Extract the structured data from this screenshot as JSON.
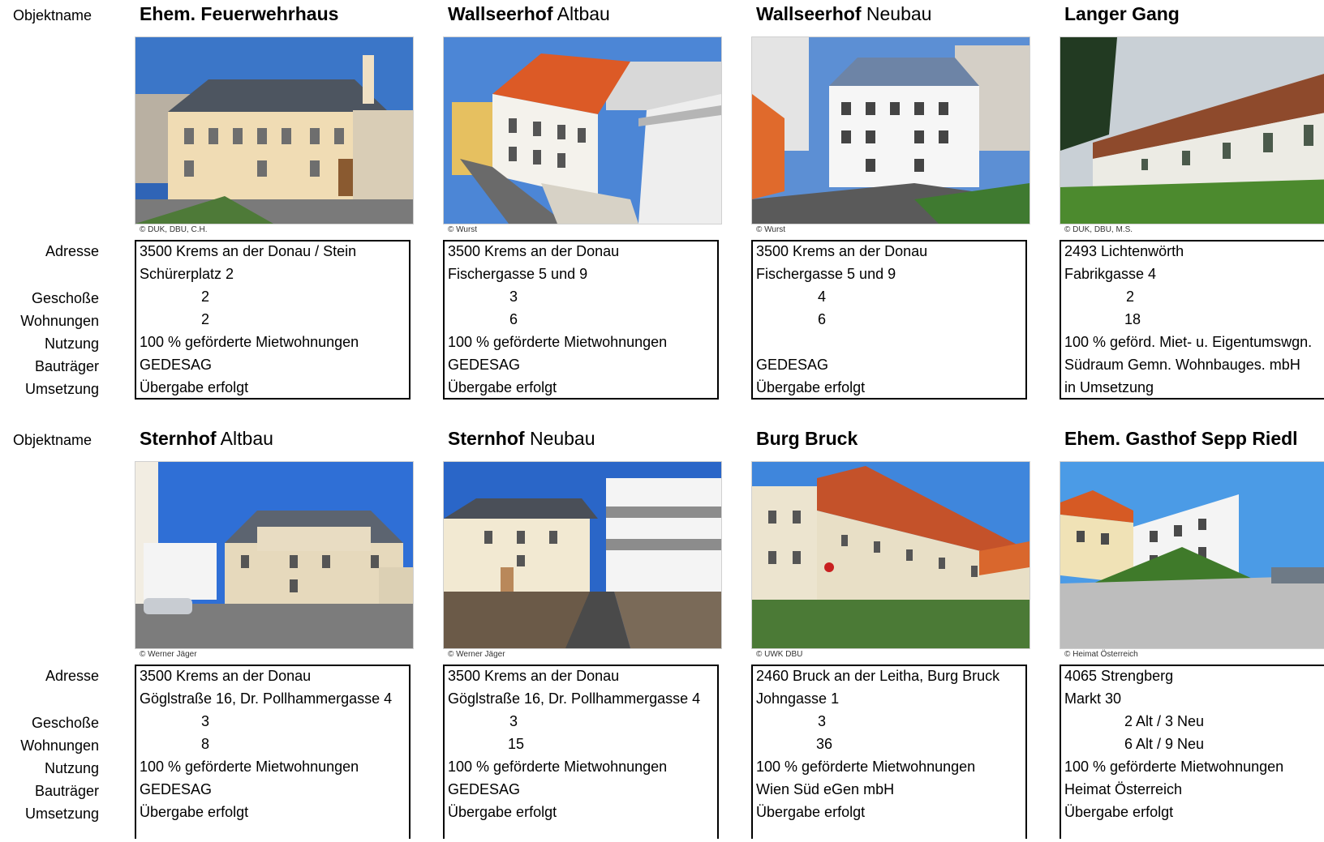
{
  "labels": {
    "objektname": "Objektname",
    "adresse": "Adresse",
    "geschosse": "Geschoße",
    "wohnungen": "Wohnungen",
    "nutzung": "Nutzung",
    "bautraeger": "Bauträger",
    "umsetzung": "Umsetzung"
  },
  "projects": [
    {
      "name_bold": "Ehem. Feuerwehrhaus",
      "name_rest": "",
      "credit": "© DUK, DBU, C.H.",
      "address1": "3500 Krems an der Donau / Stein",
      "address2": "Schürerplatz 2",
      "floors": "2",
      "units": "2",
      "usage": "100 % geförderte Mietwohnungen",
      "developer": "GEDESAG",
      "status": "Übergabe erfolgt"
    },
    {
      "name_bold": "Wallseerhof",
      "name_rest": " Altbau",
      "credit": "© Wurst",
      "address1": "3500 Krems an der Donau",
      "address2": "Fischergasse 5 und 9",
      "floors": "3",
      "units": "6",
      "usage": "100 % geförderte Mietwohnungen",
      "developer": "GEDESAG",
      "status": "Übergabe erfolgt"
    },
    {
      "name_bold": "Wallseerhof",
      "name_rest": " Neubau",
      "credit": "© Wurst",
      "address1": "3500 Krems an der Donau",
      "address2": "Fischergasse 5 und 9",
      "floors": "4",
      "units": "6",
      "usage": "",
      "developer": "GEDESAG",
      "status": "Übergabe erfolgt"
    },
    {
      "name_bold": "Langer Gang",
      "name_rest": "",
      "credit": "© DUK, DBU, M.S.",
      "address1": "2493 Lichtenwörth",
      "address2": "Fabrikgasse 4",
      "floors": "2",
      "units": "18",
      "usage": "100 % geförd. Miet- u. Eigentumswgn.",
      "developer": "Südraum Gemn. Wohnbauges. mbH",
      "status": "in Umsetzung"
    },
    {
      "name_bold": "Sternhof",
      "name_rest": " Altbau",
      "credit": "© Werner Jäger",
      "address1": "3500 Krems an der Donau",
      "address2": "Göglstraße 16, Dr. Pollhammergasse 4",
      "floors": "3",
      "units": "8",
      "usage": "100 % geförderte Mietwohnungen",
      "developer": "GEDESAG",
      "status": "Übergabe erfolgt"
    },
    {
      "name_bold": "Sternhof",
      "name_rest": " Neubau",
      "credit": "© Werner Jäger",
      "address1": "3500 Krems an der Donau",
      "address2": "Göglstraße 16, Dr. Pollhammergasse 4",
      "floors": "3",
      "units": "15",
      "usage": "100 % geförderte Mietwohnungen",
      "developer": "GEDESAG",
      "status": "Übergabe erfolgt"
    },
    {
      "name_bold": "Burg Bruck",
      "name_rest": "",
      "credit": "© UWK DBU",
      "address1": "2460 Bruck an der Leitha, Burg Bruck",
      "address2": "Johngasse 1",
      "floors": "3",
      "units": "36",
      "usage": "100 % geförderte Mietwohnungen",
      "developer": "Wien Süd eGen mbH",
      "status": "Übergabe erfolgt"
    },
    {
      "name_bold": "Ehem. Gasthof Sepp Riedl",
      "name_rest": "",
      "credit": "© Heimat Österreich",
      "address1": "4065 Strengberg",
      "address2": "Markt 30",
      "floors": "2 Alt / 3 Neu",
      "units": "6 Alt / 9 Neu",
      "usage": "100 % geförderte Mietwohnungen",
      "developer": "Heimat Österreich",
      "status": "Übergabe erfolgt"
    }
  ]
}
